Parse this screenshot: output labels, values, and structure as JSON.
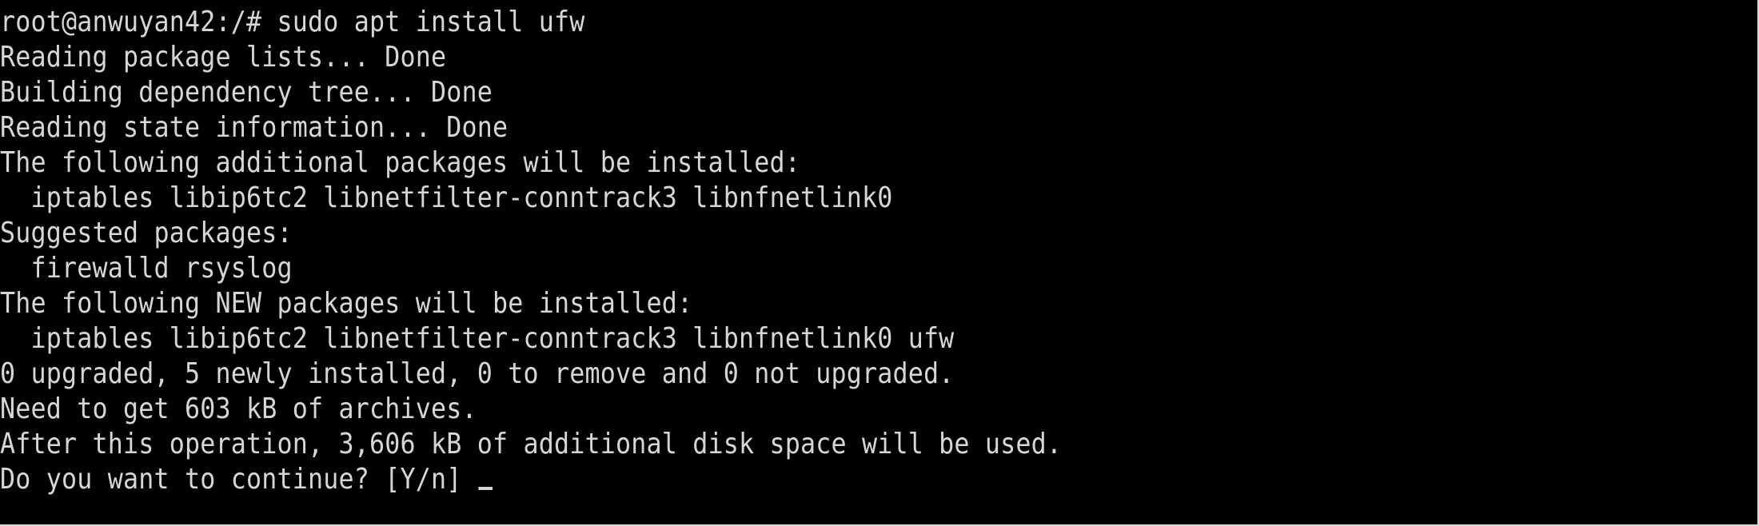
{
  "terminal": {
    "lines": [
      "root@anwuyan42:/# sudo apt install ufw",
      "Reading package lists... Done",
      "Building dependency tree... Done",
      "Reading state information... Done",
      "The following additional packages will be installed:",
      "  iptables libip6tc2 libnetfilter-conntrack3 libnfnetlink0",
      "Suggested packages:",
      "  firewalld rsyslog",
      "The following NEW packages will be installed:",
      "  iptables libip6tc2 libnetfilter-conntrack3 libnfnetlink0 ufw",
      "0 upgraded, 5 newly installed, 0 to remove and 0 not upgraded.",
      "Need to get 603 kB of archives.",
      "After this operation, 3,606 kB of additional disk space will be used.",
      "Do you want to continue? [Y/n] "
    ],
    "colors": {
      "background": "#000000",
      "foreground": "#d6d6d6"
    }
  }
}
